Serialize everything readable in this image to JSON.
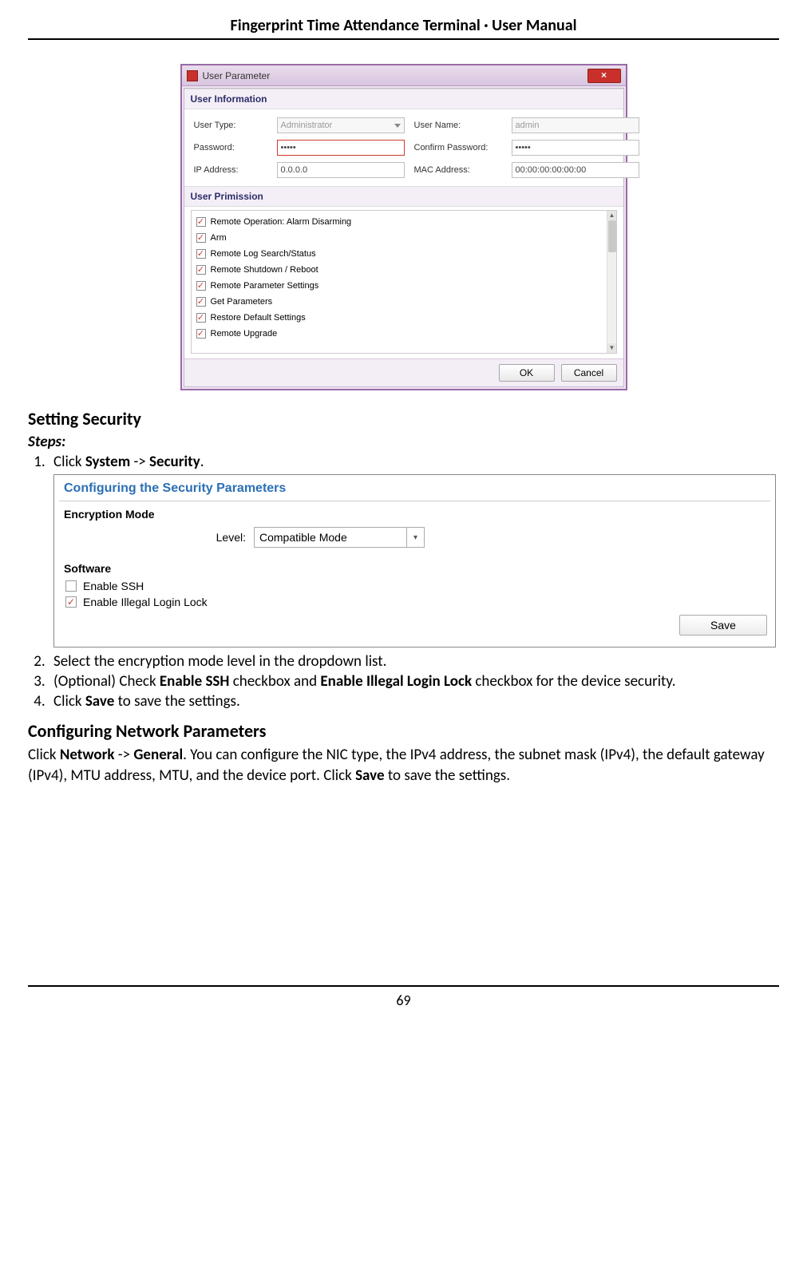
{
  "doc": {
    "header": "Fingerprint Time Attendance Terminal · User Manual",
    "page_number": "69"
  },
  "fig1": {
    "title": "User Parameter",
    "close": "×",
    "section_user_info": "User Information",
    "labels": {
      "user_type": "User Type:",
      "user_name": "User Name:",
      "password": "Password:",
      "confirm_password": "Confirm Password:",
      "ip_address": "IP Address:",
      "mac_address": "MAC Address:"
    },
    "values": {
      "user_type": "Administrator",
      "user_name": "admin",
      "password": "•••••",
      "confirm_password": "•••••",
      "ip_address": "0.0.0.0",
      "mac_address": "00:00:00:00:00:00"
    },
    "section_permission": "User Primission",
    "permissions": [
      "Remote Operation: Alarm Disarming",
      "Arm",
      "Remote Log Search/Status",
      "Remote Shutdown / Reboot",
      "Remote Parameter Settings",
      "Get Parameters",
      "Restore Default Settings",
      "Remote Upgrade"
    ],
    "buttons": {
      "ok": "OK",
      "cancel": "Cancel"
    }
  },
  "sec_security": {
    "heading": "Setting Security",
    "steps_label": "Steps:",
    "steps": {
      "s1_pre": "Click ",
      "s1_b1": "System",
      "s1_mid": " -> ",
      "s1_b2": "Security",
      "s1_post": ".",
      "s2": "Select the encryption mode level in the dropdown list.",
      "s3_pre": "(Optional) Check ",
      "s3_b1": "Enable SSH",
      "s3_mid1": " checkbox and ",
      "s3_b2": "Enable Illegal Login Lock",
      "s3_post": " checkbox for the device security.",
      "s4_pre": "Click ",
      "s4_b1": "Save",
      "s4_post": " to save the settings."
    }
  },
  "fig2": {
    "title": "Configuring the Security Parameters",
    "section_encryption": "Encryption Mode",
    "level_label": "Level:",
    "level_value": "Compatible Mode",
    "section_software": "Software",
    "chk_ssh": "Enable SSH",
    "chk_illegal": "Enable Illegal Login Lock",
    "save": "Save"
  },
  "sec_network": {
    "heading": "Configuring Network Parameters",
    "p_pre": "Click ",
    "p_b1": "Network",
    "p_mid1": " -> ",
    "p_b2": "General",
    "p_mid2": ". You can configure the NIC type, the IPv4 address, the subnet mask (IPv4), the default gateway (IPv4), MTU address, MTU, and the device port. Click ",
    "p_b3": "Save",
    "p_post": " to save the settings."
  }
}
